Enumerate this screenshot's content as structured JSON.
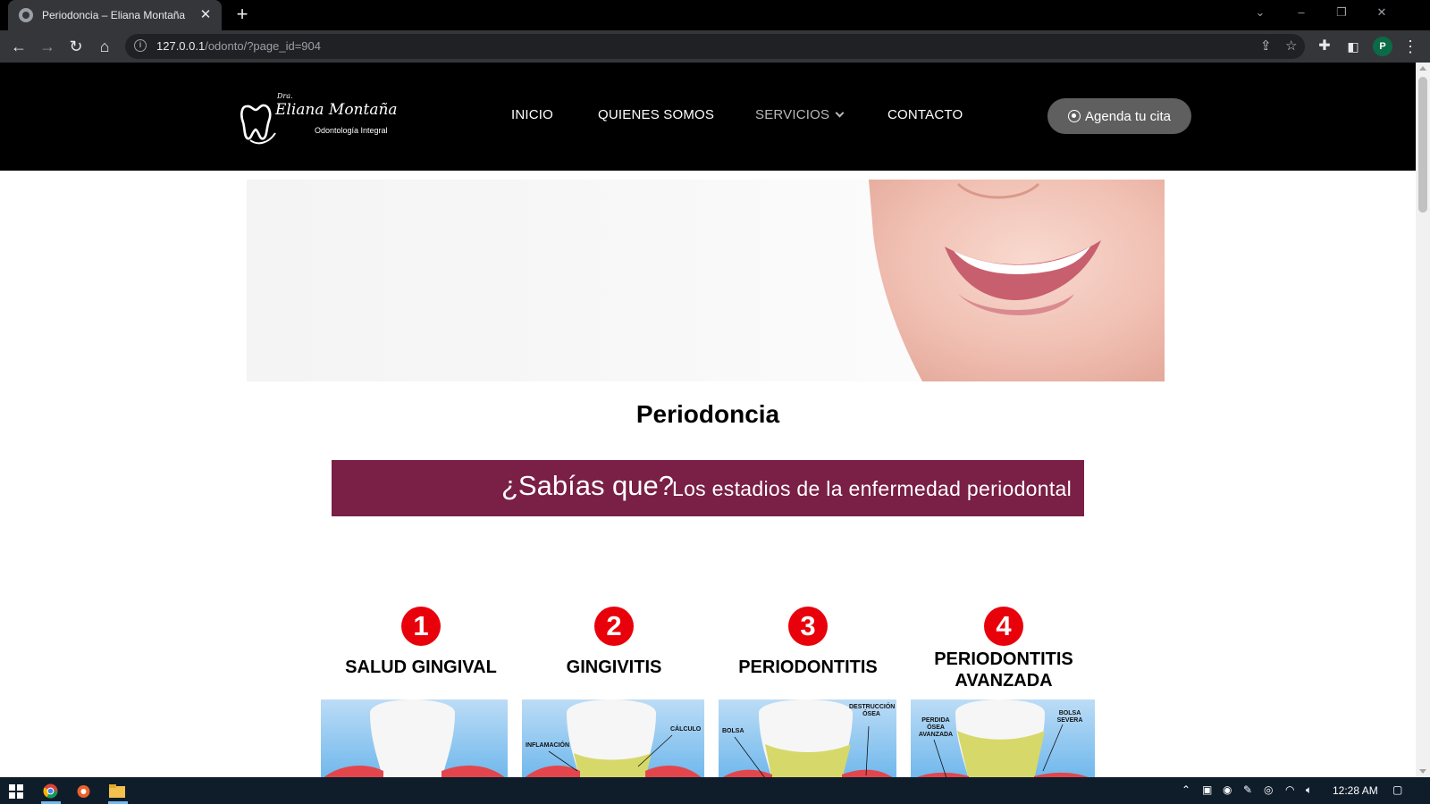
{
  "browser": {
    "tab_title": "Periodoncia – Eliana Montaña",
    "tab_close": "✕",
    "new_tab": "+",
    "url_host": "127.0.0.1",
    "url_path": "/odonto/?page_id=904",
    "profile_initial": "P"
  },
  "site": {
    "logo": {
      "prefix": "Dra.",
      "name": "Eliana Montaña",
      "tagline": "Odontología Integral"
    },
    "nav": [
      {
        "label": "INICIO"
      },
      {
        "label": "QUIENES SOMOS"
      },
      {
        "label": "SERVICIOS"
      },
      {
        "label": "CONTACTO"
      }
    ],
    "cta_label": "Agenda tu cita"
  },
  "main": {
    "page_title": "Periodoncia",
    "banner": {
      "question": "¿Sabías que?",
      "text": "Los estadios de la enfermedad periodontal"
    },
    "stages": [
      {
        "number": "1",
        "label": "SALUD GINGIVAL",
        "tags": []
      },
      {
        "number": "2",
        "label": "GINGIVITIS",
        "tags": [
          "INFLAMACIÓN",
          "CÁLCULO"
        ]
      },
      {
        "number": "3",
        "label": "PERIODONTITIS",
        "tags": [
          "BOLSA",
          "DESTRUCCIÓN ÓSEA"
        ]
      },
      {
        "number": "4",
        "label": "PERIODONTITIS AVANZADA",
        "tags": [
          "PERDIDA ÓSEA AVANZADA",
          "BOLSA SEVERA"
        ]
      }
    ]
  },
  "taskbar": {
    "time": "12:28 AM"
  },
  "colors": {
    "banner": "#7a1f45",
    "stage_number": "#e8000b",
    "header": "#000000",
    "cta": "#5f5f5f"
  }
}
